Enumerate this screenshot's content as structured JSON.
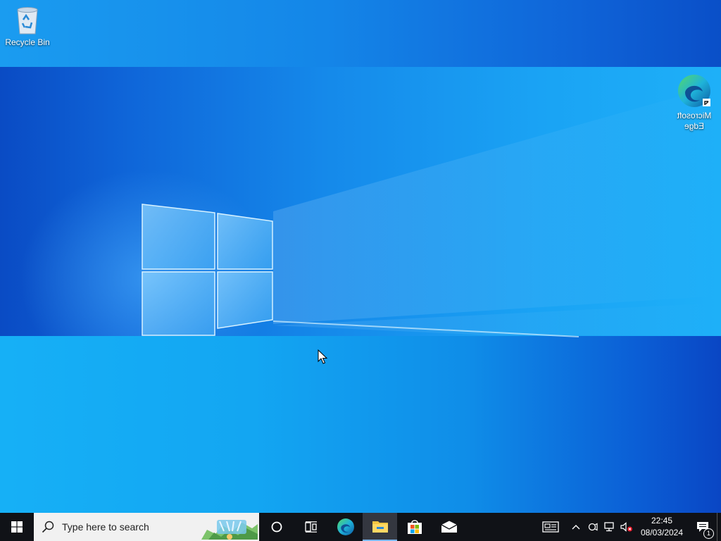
{
  "desktop": {
    "icons": [
      {
        "label": "Recycle Bin",
        "icon": "recycle-bin-icon"
      },
      {
        "label": "Microsoft Edge",
        "icon": "edge-icon"
      }
    ]
  },
  "taskbar": {
    "search": {
      "placeholder": "Type here to search"
    },
    "apps": [
      {
        "name": "cortana",
        "icon": "cortana-circle-icon"
      },
      {
        "name": "task-view",
        "icon": "task-view-icon"
      },
      {
        "name": "microsoft-edge",
        "icon": "edge-icon"
      },
      {
        "name": "file-explorer",
        "icon": "folder-icon",
        "active": true
      },
      {
        "name": "microsoft-store",
        "icon": "store-bag-icon"
      },
      {
        "name": "mail",
        "icon": "mail-icon"
      }
    ],
    "tray": {
      "icons": [
        "news-widget-icon",
        "chevron-up-icon",
        "meet-now-icon",
        "network-icon",
        "volume-muted-icon"
      ],
      "time": "22:45",
      "date": "08/03/2024",
      "notification_count": "1"
    }
  },
  "colors": {
    "taskbar_bg": "#101217",
    "search_bg": "#f1f1f1",
    "active_indicator": "#7ab8f5"
  }
}
